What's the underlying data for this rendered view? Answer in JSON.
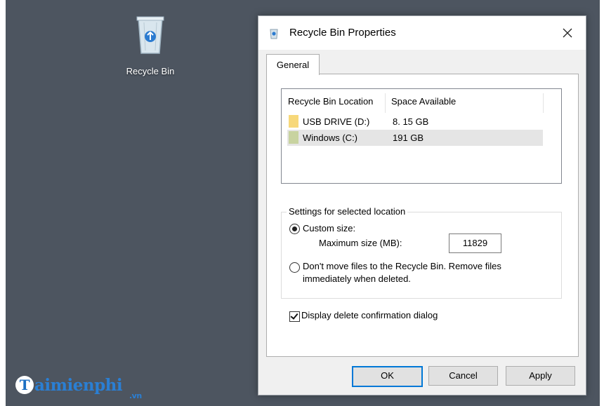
{
  "desktop": {
    "icon_label": "Recycle Bin",
    "watermark_brand": "aimienphi",
    "watermark_initial": "T",
    "watermark_suffix": ".vn"
  },
  "dialog": {
    "title": "Recycle Bin Properties",
    "tab": "General",
    "list": {
      "col_location": "Recycle Bin Location",
      "col_space": "Space Available",
      "rows": [
        {
          "name": "USB DRIVE (D:)",
          "space": "8. 15 GB",
          "drive_color": "#f7d87a",
          "selected": false
        },
        {
          "name": "Windows (C:)",
          "space": "191 GB",
          "drive_color": "#c8d3a0",
          "selected": true
        }
      ]
    },
    "settings": {
      "group_title": "Settings for selected location",
      "custom_size_label": "Custom size:",
      "custom_size_selected": true,
      "max_size_label": "Maximum size (MB):",
      "max_size_value": "11829",
      "dont_move_line1": "Don't move files to the Recycle Bin. Remove files",
      "dont_move_line2": "immediately when deleted.",
      "dont_move_selected": false
    },
    "confirm_label": "Display delete confirmation dialog",
    "confirm_checked": true,
    "buttons": {
      "ok": "OK",
      "cancel": "Cancel",
      "apply": "Apply"
    }
  }
}
